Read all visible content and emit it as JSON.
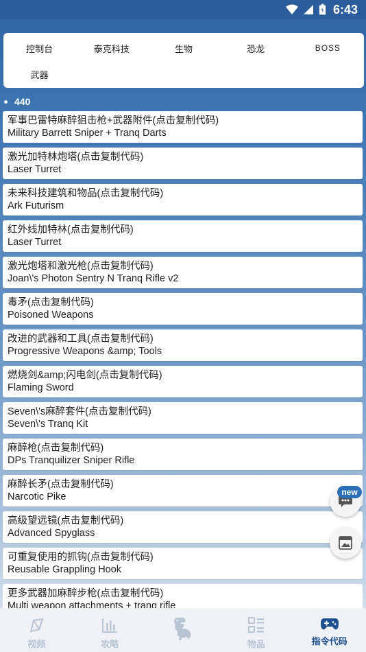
{
  "status_bar": {
    "time": "6:43"
  },
  "categories": [
    {
      "label": "控制台"
    },
    {
      "label": "泰克科技"
    },
    {
      "label": "生物"
    },
    {
      "label": "恐龙"
    },
    {
      "label": "BOSS"
    },
    {
      "label": "武器"
    }
  ],
  "list_count": "440",
  "items": [
    {
      "zh": "军事巴雷特麻醉狙击枪+武器附件(点击复制代码)",
      "en": "Military Barrett Sniper + Tranq Darts"
    },
    {
      "zh": "激光加特林炮塔(点击复制代码)",
      "en": "Laser Turret"
    },
    {
      "zh": "未来科技建筑和物品(点击复制代码)",
      "en": "Ark Futurism"
    },
    {
      "zh": "红外线加特林(点击复制代码)",
      "en": "Laser Turret"
    },
    {
      "zh": "激光炮塔和激光枪(点击复制代码)",
      "en": "Joan\\'s Photon Sentry N Tranq Rifle v2"
    },
    {
      "zh": "毒矛(点击复制代码)",
      "en": "Poisoned Weapons"
    },
    {
      "zh": "改进的武器和工具(点击复制代码)",
      "en": "Progressive Weapons &amp; Tools"
    },
    {
      "zh": "燃烧剑&amp;闪电剑(点击复制代码)",
      "en": "Flaming Sword"
    },
    {
      "zh": "Seven\\'s麻醉套件(点击复制代码)",
      "en": "Seven\\'s Tranq Kit"
    },
    {
      "zh": "麻醉枪(点击复制代码)",
      "en": "DPs Tranquilizer Sniper Rifle"
    },
    {
      "zh": "麻醉长矛(点击复制代码)",
      "en": "Narcotic Pike"
    },
    {
      "zh": "高级望远镜(点击复制代码)",
      "en": "Advanced Spyglass"
    },
    {
      "zh": "可重复使用的抓钩(点击复制代码)",
      "en": "Reusable Grappling Hook"
    },
    {
      "zh": "更多武器加麻醉步枪(点击复制代码)",
      "en": "Multi weapon attachments + tranq rifle"
    }
  ],
  "fab": {
    "badge": "new"
  },
  "bottom_nav": [
    {
      "label": "视频",
      "icon": "compass-icon"
    },
    {
      "label": "攻略",
      "icon": "bar-chart-icon"
    },
    {
      "label": "",
      "icon": "dinosaur-icon"
    },
    {
      "label": "物品",
      "icon": "grid-list-icon"
    },
    {
      "label": "指令代码",
      "icon": "gamepad-icon"
    }
  ],
  "colors": {
    "header_blue": "#2b5c9b",
    "accent": "#1d4f8f",
    "inactive_nav": "#b9c4d3"
  }
}
